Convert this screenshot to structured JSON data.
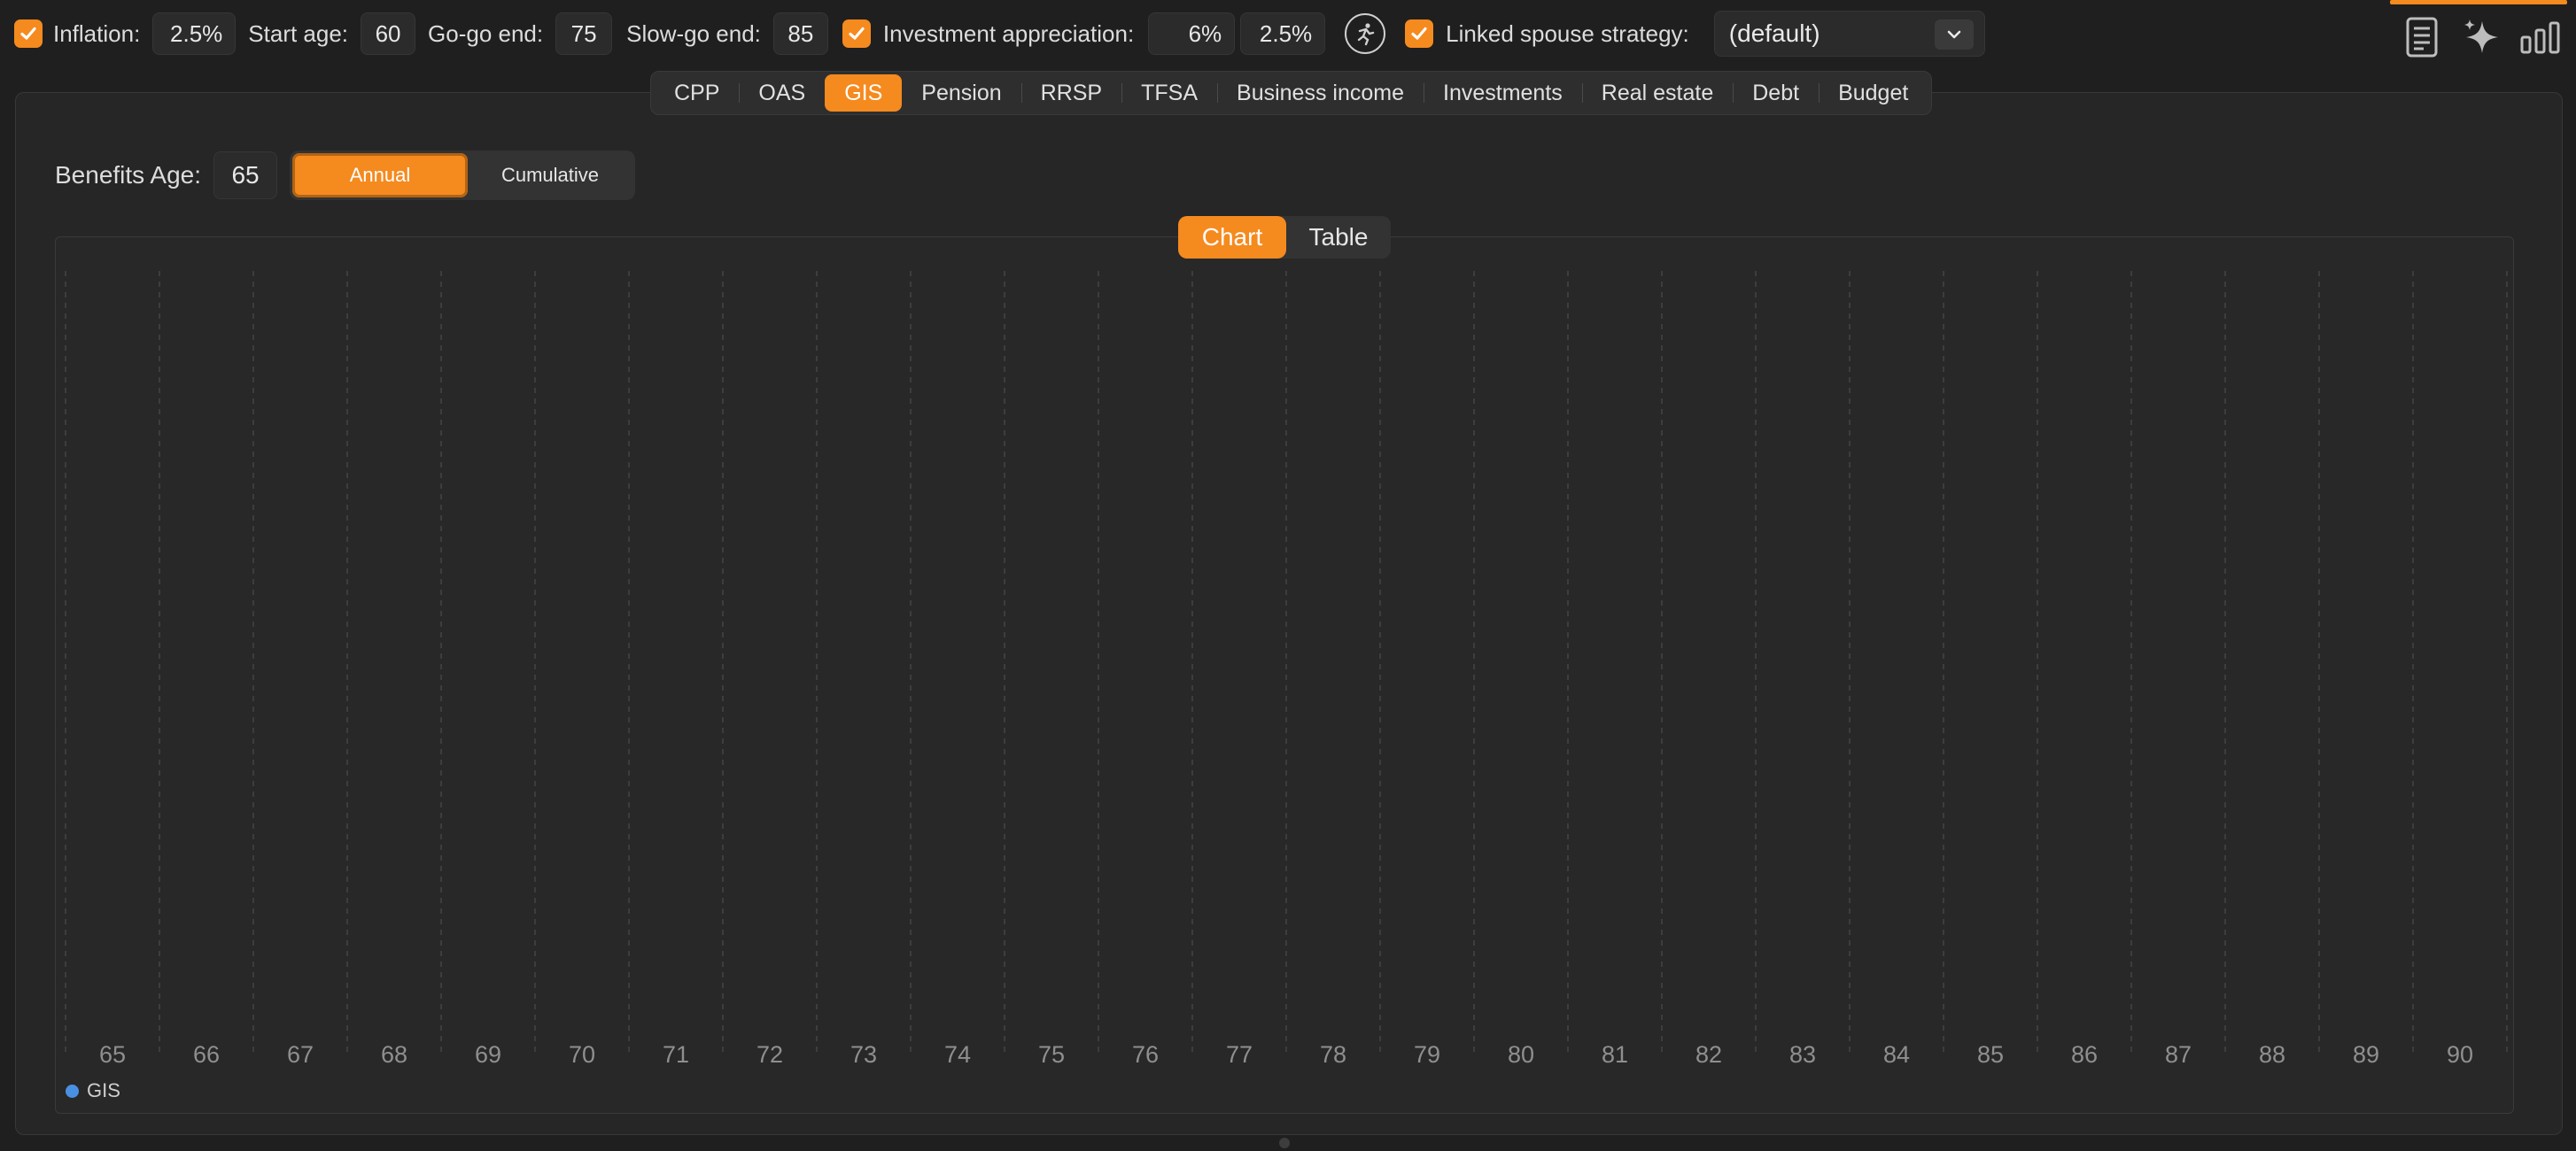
{
  "toolbar": {
    "inflation_label": "Inflation:",
    "inflation_value": "2.5%",
    "start_age_label": "Start age:",
    "start_age_value": "60",
    "gogo_label": "Go-go end:",
    "gogo_value": "75",
    "slowgo_label": "Slow-go end:",
    "slowgo_value": "85",
    "investment_label": "Investment appreciation:",
    "investment_value_1": "6%",
    "investment_value_2": "2.5%",
    "linked_label": "Linked spouse strategy:",
    "strategy_value": "(default)"
  },
  "tabs": [
    {
      "label": "CPP",
      "active": false
    },
    {
      "label": "OAS",
      "active": false
    },
    {
      "label": "GIS",
      "active": true
    },
    {
      "label": "Pension",
      "active": false
    },
    {
      "label": "RRSP",
      "active": false
    },
    {
      "label": "TFSA",
      "active": false
    },
    {
      "label": "Business income",
      "active": false
    },
    {
      "label": "Investments",
      "active": false
    },
    {
      "label": "Real estate",
      "active": false
    },
    {
      "label": "Debt",
      "active": false
    },
    {
      "label": "Budget",
      "active": false
    }
  ],
  "benefits": {
    "label": "Benefits Age:",
    "value": "65",
    "annual_label": "Annual",
    "cumulative_label": "Cumulative"
  },
  "view_toggle": {
    "chart_label": "Chart",
    "table_label": "Table"
  },
  "colors": {
    "accent": "#f58a1f",
    "series_gis": "#4a90e2"
  },
  "chart_data": {
    "type": "bar",
    "categories": [
      "65",
      "66",
      "67",
      "68",
      "69",
      "70",
      "71",
      "72",
      "73",
      "74",
      "75",
      "76",
      "77",
      "78",
      "79",
      "80",
      "81",
      "82",
      "83",
      "84",
      "85",
      "86",
      "87",
      "88",
      "89",
      "90"
    ],
    "series": [
      {
        "name": "GIS",
        "values": [
          0,
          0,
          0,
          0,
          0,
          0,
          0,
          0,
          0,
          0,
          0,
          0,
          0,
          0,
          0,
          0,
          0,
          0,
          0,
          0,
          0,
          0,
          0,
          0,
          0,
          0
        ]
      }
    ],
    "legend": "bottom-left",
    "grid": true
  }
}
